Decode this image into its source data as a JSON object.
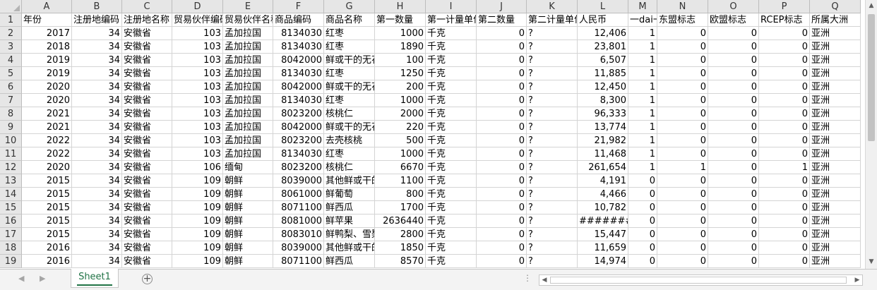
{
  "columns": [
    "A",
    "B",
    "C",
    "D",
    "E",
    "F",
    "G",
    "H",
    "I",
    "J",
    "K",
    "L",
    "M",
    "N",
    "O",
    "P",
    "Q"
  ],
  "rows": [
    {
      "n": "1",
      "header": true,
      "cells": [
        "年份",
        "注册地编码",
        "注册地名称",
        "贸易伙伴编码",
        "贸易伙伴名称",
        "商品编码",
        "商品名称",
        "第一数量",
        "第一计量单位",
        "第二数量",
        "第二计量单位",
        "人民币",
        "一dai一lu",
        "东盟标志",
        "欧盟标志",
        "RCEP标志",
        "所属大洲"
      ]
    },
    {
      "n": "2",
      "cells": [
        "2017",
        "34",
        "安徽省",
        "103",
        "孟加拉国",
        "8134030",
        "红枣",
        "1000",
        "千克",
        "0",
        "?",
        "12,406",
        "1",
        "0",
        "0",
        "0",
        "亚洲"
      ]
    },
    {
      "n": "3",
      "cells": [
        "2018",
        "34",
        "安徽省",
        "103",
        "孟加拉国",
        "8134030",
        "红枣",
        "1890",
        "千克",
        "0",
        "?",
        "23,801",
        "1",
        "0",
        "0",
        "0",
        "亚洲"
      ]
    },
    {
      "n": "4",
      "cells": [
        "2019",
        "34",
        "安徽省",
        "103",
        "孟加拉国",
        "8042000",
        "鲜或干的无花果",
        "100",
        "千克",
        "0",
        "?",
        "6,507",
        "1",
        "0",
        "0",
        "0",
        "亚洲"
      ]
    },
    {
      "n": "5",
      "cells": [
        "2019",
        "34",
        "安徽省",
        "103",
        "孟加拉国",
        "8134030",
        "红枣",
        "1250",
        "千克",
        "0",
        "?",
        "11,885",
        "1",
        "0",
        "0",
        "0",
        "亚洲"
      ]
    },
    {
      "n": "6",
      "cells": [
        "2020",
        "34",
        "安徽省",
        "103",
        "孟加拉国",
        "8042000",
        "鲜或干的无花果",
        "200",
        "千克",
        "0",
        "?",
        "12,450",
        "1",
        "0",
        "0",
        "0",
        "亚洲"
      ]
    },
    {
      "n": "7",
      "cells": [
        "2020",
        "34",
        "安徽省",
        "103",
        "孟加拉国",
        "8134030",
        "红枣",
        "1000",
        "千克",
        "0",
        "?",
        "8,300",
        "1",
        "0",
        "0",
        "0",
        "亚洲"
      ]
    },
    {
      "n": "8",
      "cells": [
        "2021",
        "34",
        "安徽省",
        "103",
        "孟加拉国",
        "8023200",
        "核桃仁",
        "2000",
        "千克",
        "0",
        "?",
        "96,333",
        "1",
        "0",
        "0",
        "0",
        "亚洲"
      ]
    },
    {
      "n": "9",
      "cells": [
        "2021",
        "34",
        "安徽省",
        "103",
        "孟加拉国",
        "8042000",
        "鲜或干的无花果",
        "220",
        "千克",
        "0",
        "?",
        "13,774",
        "1",
        "0",
        "0",
        "0",
        "亚洲"
      ]
    },
    {
      "n": "10",
      "cells": [
        "2022",
        "34",
        "安徽省",
        "103",
        "孟加拉国",
        "8023200",
        "去壳核桃",
        "500",
        "千克",
        "0",
        "?",
        "21,982",
        "1",
        "0",
        "0",
        "0",
        "亚洲"
      ]
    },
    {
      "n": "11",
      "cells": [
        "2022",
        "34",
        "安徽省",
        "103",
        "孟加拉国",
        "8134030",
        "红枣",
        "1000",
        "千克",
        "0",
        "?",
        "11,468",
        "1",
        "0",
        "0",
        "0",
        "亚洲"
      ]
    },
    {
      "n": "12",
      "cells": [
        "2020",
        "34",
        "安徽省",
        "106",
        "缅甸",
        "8023200",
        "核桃仁",
        "6670",
        "千克",
        "0",
        "?",
        "261,654",
        "1",
        "1",
        "0",
        "1",
        "亚洲"
      ]
    },
    {
      "n": "13",
      "cells": [
        "2015",
        "34",
        "安徽省",
        "109",
        "朝鲜",
        "8039000",
        "其他鲜或干的",
        "1100",
        "千克",
        "0",
        "?",
        "4,191",
        "0",
        "0",
        "0",
        "0",
        "亚洲"
      ]
    },
    {
      "n": "14",
      "cells": [
        "2015",
        "34",
        "安徽省",
        "109",
        "朝鲜",
        "8061000",
        "鲜葡萄",
        "800",
        "千克",
        "0",
        "?",
        "4,466",
        "0",
        "0",
        "0",
        "0",
        "亚洲"
      ]
    },
    {
      "n": "15",
      "cells": [
        "2015",
        "34",
        "安徽省",
        "109",
        "朝鲜",
        "8071100",
        "鲜西瓜",
        "1700",
        "千克",
        "0",
        "?",
        "10,782",
        "0",
        "0",
        "0",
        "0",
        "亚洲"
      ]
    },
    {
      "n": "16",
      "cells": [
        "2015",
        "34",
        "安徽省",
        "109",
        "朝鲜",
        "8081000",
        "鲜苹果",
        "2636440",
        "千克",
        "0",
        "?",
        "#######",
        "0",
        "0",
        "0",
        "0",
        "亚洲"
      ]
    },
    {
      "n": "17",
      "cells": [
        "2015",
        "34",
        "安徽省",
        "109",
        "朝鲜",
        "8083010",
        "鲜鸭梨、雪梨",
        "2800",
        "千克",
        "0",
        "?",
        "15,447",
        "0",
        "0",
        "0",
        "0",
        "亚洲"
      ]
    },
    {
      "n": "18",
      "cells": [
        "2016",
        "34",
        "安徽省",
        "109",
        "朝鲜",
        "8039000",
        "其他鲜或干的",
        "1850",
        "千克",
        "0",
        "?",
        "11,659",
        "0",
        "0",
        "0",
        "0",
        "亚洲"
      ]
    },
    {
      "n": "19",
      "cells": [
        "2016",
        "34",
        "安徽省",
        "109",
        "朝鲜",
        "8071100",
        "鲜西瓜",
        "8570",
        "千克",
        "0",
        "?",
        "14,974",
        "0",
        "0",
        "0",
        "0",
        "亚洲"
      ]
    }
  ],
  "numeric_columns": [
    0,
    1,
    3,
    5,
    7,
    9,
    11,
    12,
    13,
    14,
    15
  ],
  "sheet_tab": "Sheet1",
  "add_sheet": "+",
  "arrows": {
    "up": "▲",
    "down": "▼",
    "left": "◀",
    "right": "▶",
    "nav_left": "◀",
    "nav_right": "▶"
  },
  "dots": "⋮"
}
